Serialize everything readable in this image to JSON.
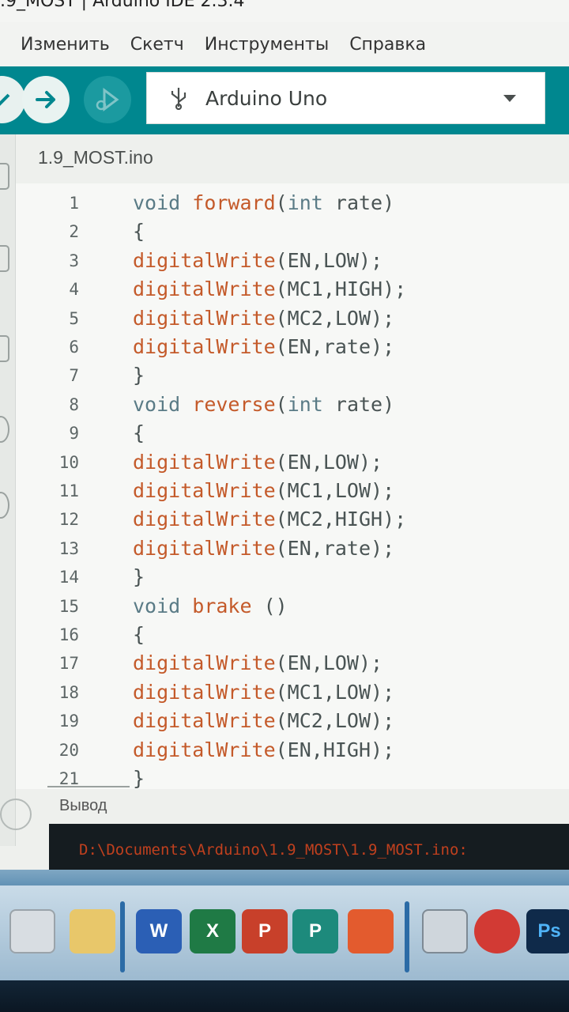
{
  "window": {
    "title": ".9_MOST | Arduino IDE 2.3.4"
  },
  "menu": {
    "items": [
      "Изменить",
      "Скетч",
      "Инструменты",
      "Справка"
    ]
  },
  "toolbar": {
    "verify_icon": "check-icon",
    "upload_icon": "arrow-right-icon",
    "debug_icon": "debug-icon",
    "board": "Arduino Uno",
    "board_icon": "usb-icon"
  },
  "editor": {
    "tab_name": "1.9_MOST.ino",
    "lines": [
      {
        "n": "1",
        "parts": [
          [
            "kw",
            "void "
          ],
          [
            "fn",
            "forward"
          ],
          [
            "punct",
            "("
          ],
          [
            "tp",
            "int"
          ],
          [
            "punct",
            " rate)"
          ]
        ]
      },
      {
        "n": "2",
        "parts": [
          [
            "punct",
            "{"
          ]
        ]
      },
      {
        "n": "3",
        "parts": [
          [
            "fn",
            "digitalWrite"
          ],
          [
            "punct",
            "(EN,LOW);"
          ]
        ]
      },
      {
        "n": "4",
        "parts": [
          [
            "fn",
            "digitalWrite"
          ],
          [
            "punct",
            "(MC1,HIGH);"
          ]
        ]
      },
      {
        "n": "5",
        "parts": [
          [
            "fn",
            "digitalWrite"
          ],
          [
            "punct",
            "(MC2,LOW);"
          ]
        ]
      },
      {
        "n": "6",
        "parts": [
          [
            "fn",
            "digitalWrite"
          ],
          [
            "punct",
            "(EN,rate);"
          ]
        ]
      },
      {
        "n": "7",
        "parts": [
          [
            "punct",
            "}"
          ]
        ]
      },
      {
        "n": "8",
        "parts": [
          [
            "kw",
            "void "
          ],
          [
            "fn",
            "reverse"
          ],
          [
            "punct",
            "("
          ],
          [
            "tp",
            "int"
          ],
          [
            "punct",
            " rate)"
          ]
        ]
      },
      {
        "n": "9",
        "parts": [
          [
            "punct",
            "{"
          ]
        ]
      },
      {
        "n": "10",
        "parts": [
          [
            "fn",
            "digitalWrite"
          ],
          [
            "punct",
            "(EN,LOW);"
          ]
        ]
      },
      {
        "n": "11",
        "parts": [
          [
            "fn",
            "digitalWrite"
          ],
          [
            "punct",
            "(MC1,LOW);"
          ]
        ]
      },
      {
        "n": "12",
        "parts": [
          [
            "fn",
            "digitalWrite"
          ],
          [
            "punct",
            "(MC2,HIGH);"
          ]
        ]
      },
      {
        "n": "13",
        "parts": [
          [
            "fn",
            "digitalWrite"
          ],
          [
            "punct",
            "(EN,rate);"
          ]
        ]
      },
      {
        "n": "14",
        "parts": [
          [
            "punct",
            "}"
          ]
        ]
      },
      {
        "n": "15",
        "parts": [
          [
            "kw",
            "void "
          ],
          [
            "fn",
            "brake"
          ],
          [
            "punct",
            " ()"
          ]
        ]
      },
      {
        "n": "16",
        "parts": [
          [
            "punct",
            "{"
          ]
        ]
      },
      {
        "n": "17",
        "parts": [
          [
            "fn",
            "digitalWrite"
          ],
          [
            "punct",
            "(EN,LOW);"
          ]
        ]
      },
      {
        "n": "18",
        "parts": [
          [
            "fn",
            "digitalWrite"
          ],
          [
            "punct",
            "(MC1,LOW);"
          ]
        ]
      },
      {
        "n": "19",
        "parts": [
          [
            "fn",
            "digitalWrite"
          ],
          [
            "punct",
            "(MC2,LOW);"
          ]
        ]
      },
      {
        "n": "20",
        "parts": [
          [
            "fn",
            "digitalWrite"
          ],
          [
            "punct",
            "(EN,HIGH);"
          ]
        ]
      },
      {
        "n": "21",
        "parts": [
          [
            "punct",
            "}"
          ]
        ]
      }
    ]
  },
  "output": {
    "label": "Вывод",
    "console_text": "D:\\Documents\\Arduino\\1.9_MOST\\1.9_MOST.ino:"
  },
  "taskbar": {
    "icons": [
      "network-icon",
      "folder-icon",
      "word-icon",
      "excel-icon",
      "powerpoint-icon",
      "publisher-icon",
      "pdf-icon",
      "scanner-icon",
      "recorder-icon",
      "photoshop-icon"
    ],
    "word_letter": "W",
    "excel_letter": "X",
    "powerpoint_letter": "P",
    "publisher_letter": "P",
    "photoshop_letter": "Ps"
  },
  "colors": {
    "toolbar": "#00878f",
    "keyword": "#5a7b86",
    "function": "#c45a2a",
    "text": "#475252",
    "console_bg": "#151c20",
    "console_text": "#c0401e"
  }
}
